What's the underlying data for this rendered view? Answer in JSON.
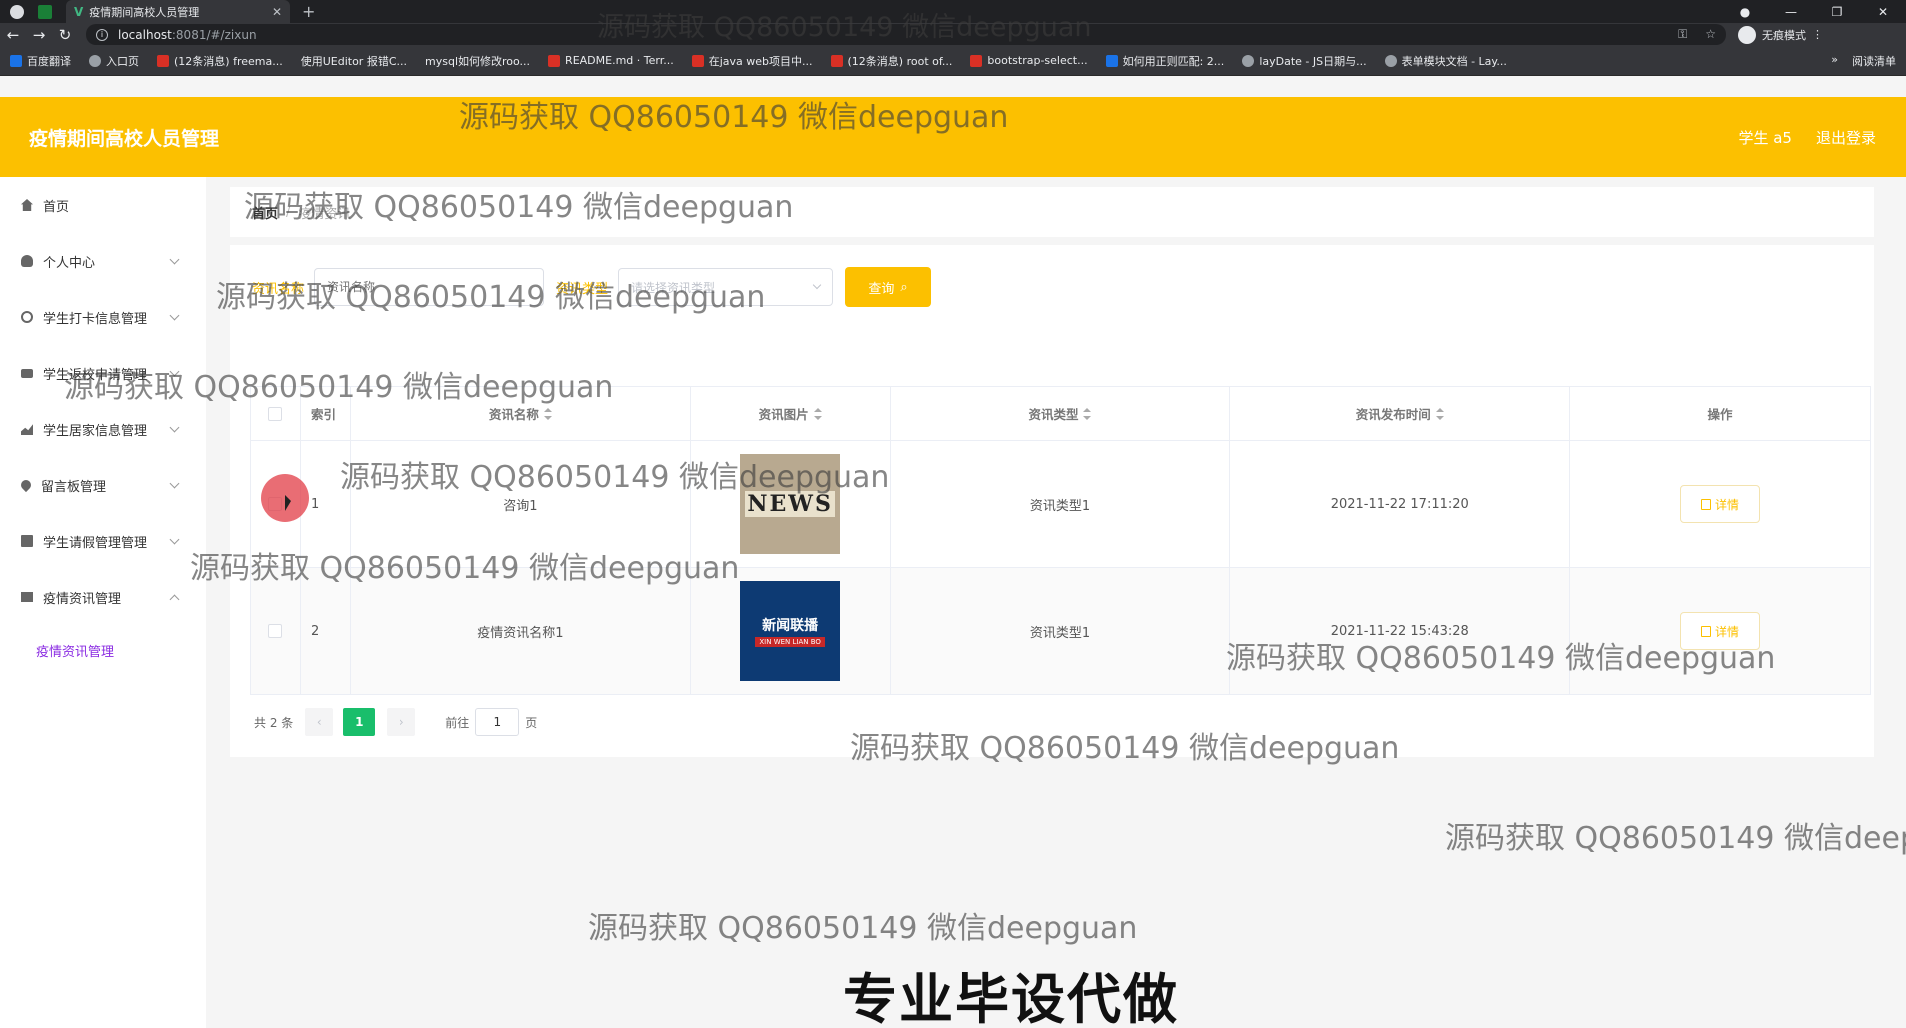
{
  "browser": {
    "tab_title": "疫情期间高校人员管理",
    "url_host": "localhost",
    "url_path": ":8081/#/zixun",
    "incognito_label": "无痕模式",
    "bookmarks": [
      "百度翻译",
      "入口页",
      "(12条消息) freema...",
      "使用UEditor 报错C...",
      "mysql如何修改roo...",
      "README.md · Terr...",
      "在java web项目中...",
      "(12条消息) root of...",
      "bootstrap-select...",
      "如何用正则匹配: 2...",
      "layDate - JS日期与...",
      "表单模块文档 - Lay..."
    ],
    "reading_list": "阅读清单"
  },
  "header": {
    "title": "疫情期间高校人员管理",
    "user": "学生 a5",
    "logout": "退出登录"
  },
  "sidebar": {
    "items": [
      {
        "label": "首页",
        "icon": "home-icon"
      },
      {
        "label": "个人中心",
        "icon": "user-icon"
      },
      {
        "label": "学生打卡信息管理",
        "icon": "circle-icon"
      },
      {
        "label": "学生返校申请管理",
        "icon": "briefcase-icon"
      },
      {
        "label": "学生居家信息管理",
        "icon": "chart-icon"
      },
      {
        "label": "留言板管理",
        "icon": "pin-icon"
      },
      {
        "label": "学生请假管理管理",
        "icon": "document-icon"
      },
      {
        "label": "疫情资讯管理",
        "icon": "news-icon"
      }
    ],
    "submenu": "疫情资讯管理"
  },
  "breadcrumb": {
    "home": "首页",
    "current": "疫情资讯"
  },
  "search": {
    "name_label": "资讯名称",
    "name_placeholder": "资讯名称",
    "type_label": "资讯类型",
    "type_placeholder": "请选择资讯类型",
    "button": "查询"
  },
  "table": {
    "headers": [
      "索引",
      "资讯名称",
      "资讯图片",
      "资讯类型",
      "资讯发布时间",
      "操作"
    ],
    "rows": [
      {
        "index": "1",
        "name": "咨询1",
        "image": "NEWS",
        "type": "资讯类型1",
        "time": "2021-11-22 17:11:20",
        "action": "详情"
      },
      {
        "index": "2",
        "name": "疫情资讯名称1",
        "image": "新闻联播",
        "image_sub": "XIN WEN LIAN BO",
        "type": "资讯类型1",
        "time": "2021-11-22 15:43:28",
        "action": "详情"
      }
    ]
  },
  "pagination": {
    "total": "共 2 条",
    "current": "1",
    "goto": "前往",
    "goto_value": "1",
    "page_suffix": "页"
  },
  "overlay": {
    "watermark": "源码获取 QQ86050149 微信deepguan",
    "watermark_cut": "源码获取 QQ86050149 微信deep",
    "banner": "专业毕设代做"
  },
  "colors": {
    "accent": "#fcc000",
    "active_page": "#19be6b",
    "submenu": "#8a2be2"
  }
}
